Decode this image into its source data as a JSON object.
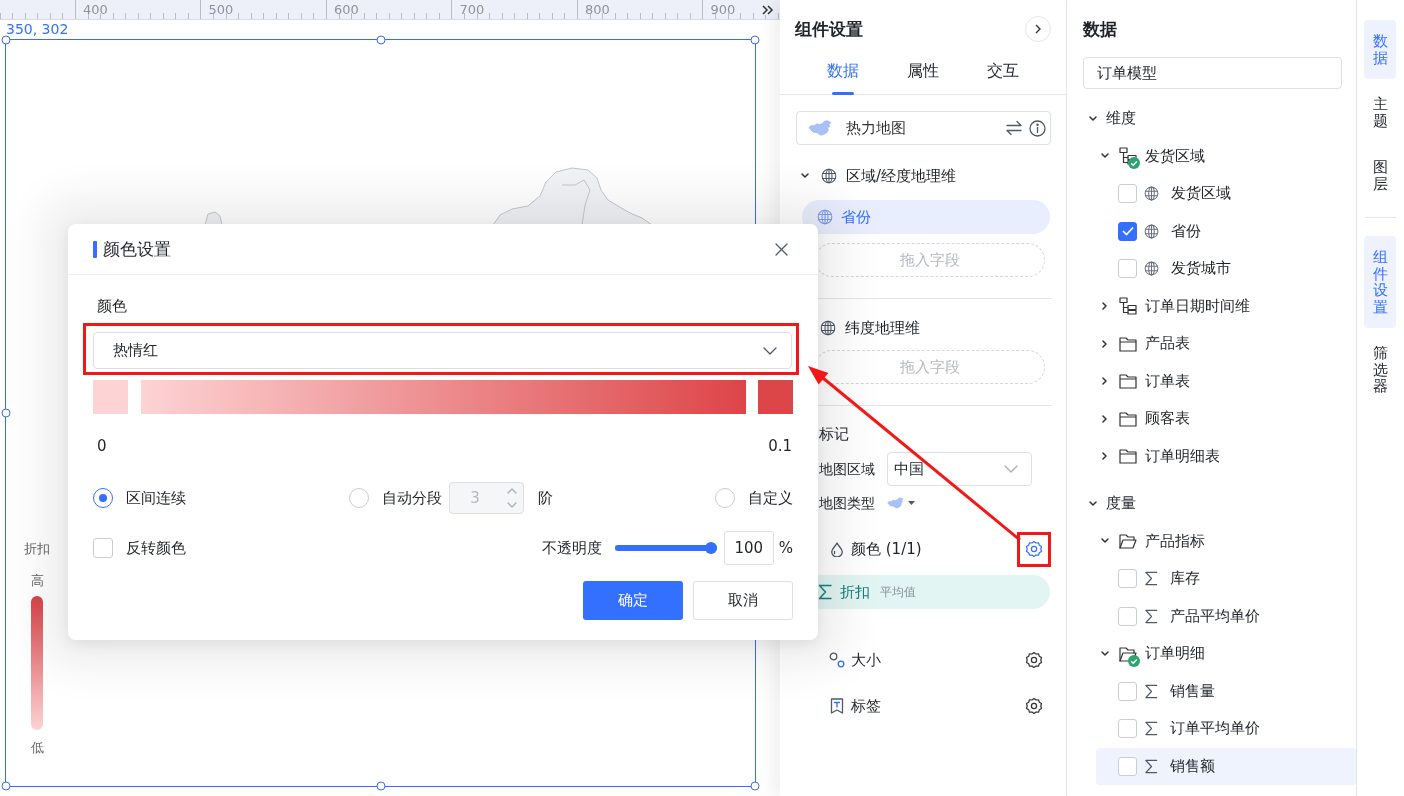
{
  "canvas": {
    "ruler_labels": [
      "400",
      "500",
      "600",
      "700",
      "800",
      "900"
    ],
    "position": "350, 302",
    "legend": {
      "title": "折扣",
      "high": "高",
      "low": "低"
    }
  },
  "color_dialog": {
    "title": "颜色设置",
    "color_label": "颜色",
    "scheme": {
      "value": "热情红",
      "highlighted": true
    },
    "scale_min": "0",
    "scale_max": "0.1",
    "modes": [
      {
        "kind": "plain",
        "label": "区间连续",
        "selected": true
      },
      {
        "kind": "steps",
        "label": "自动分段",
        "selected": false,
        "steps": {
          "value": "3",
          "disabled": true
        },
        "unit": "阶"
      },
      {
        "kind": "plain",
        "label": "自定义",
        "selected": false
      }
    ],
    "reverse": {
      "label": "反转颜色",
      "checked": false
    },
    "opacity": {
      "label": "不透明度",
      "level": 1,
      "value": "100",
      "unit": "%"
    },
    "buttons": [
      {
        "kind": "primary",
        "label": "确定"
      },
      {
        "kind": "secondary",
        "label": "取消"
      }
    ]
  },
  "component_panel": {
    "title": "组件设置",
    "tabs": [
      {
        "label": "数据",
        "selected": true
      },
      {
        "label": "属性",
        "selected": false
      },
      {
        "label": "交互",
        "selected": false
      }
    ],
    "chart_type": "热力地图",
    "region_dimension": {
      "title": "区域/经度地理维",
      "expanded": true,
      "fields": [
        "省份"
      ],
      "drop_hint": "拖入字段"
    },
    "latitude_dimension": {
      "title": "纬度地理维",
      "drop_hint": "拖入字段"
    },
    "marks": {
      "title": "标记",
      "map_region": {
        "label": "地图区域",
        "value": "中国"
      },
      "map_type": {
        "label": "地图类型"
      },
      "channels": [
        {
          "kind": "color",
          "label": "颜色 (1/1)",
          "active": true,
          "highlighted": true,
          "field": {
            "label": "折扣",
            "aggregation": "平均值"
          }
        },
        {
          "kind": "size",
          "label": "大小",
          "active": false,
          "highlighted": false
        },
        {
          "kind": "label",
          "label": "标签",
          "active": false,
          "highlighted": false
        }
      ]
    }
  },
  "annotation_arrow": true,
  "data_panel": {
    "title": "数据",
    "model": "订单模型",
    "tree": [
      {
        "label": "维度",
        "expanded": true,
        "children": [
          {
            "kind": "hierarchy",
            "label": "发货区域",
            "expanded": true,
            "in_use": true,
            "children": [
              {
                "kind": "geo",
                "label": "发货区域",
                "checked": false,
                "selected": false
              },
              {
                "kind": "geo",
                "label": "省份",
                "checked": true,
                "selected": false
              },
              {
                "kind": "geo",
                "label": "发货城市",
                "checked": false,
                "selected": false
              }
            ]
          },
          {
            "kind": "hierarchy",
            "label": "订单日期时间维",
            "expanded": false,
            "in_use": false
          },
          {
            "kind": "folder",
            "label": "产品表",
            "expanded": false,
            "in_use": false
          },
          {
            "kind": "folder",
            "label": "订单表",
            "expanded": false,
            "in_use": false
          },
          {
            "kind": "folder",
            "label": "顾客表",
            "expanded": false,
            "in_use": false
          },
          {
            "kind": "folder",
            "label": "订单明细表",
            "expanded": false,
            "in_use": false
          }
        ]
      },
      {
        "label": "度量",
        "expanded": true,
        "children": [
          {
            "kind": "folder",
            "label": "产品指标",
            "expanded": true,
            "in_use": false,
            "children": [
              {
                "kind": "measure",
                "label": "库存",
                "checked": false,
                "selected": false
              },
              {
                "kind": "measure",
                "label": "产品平均单价",
                "checked": false,
                "selected": false
              }
            ]
          },
          {
            "kind": "folder",
            "label": "订单明细",
            "expanded": true,
            "in_use": true,
            "children": [
              {
                "kind": "measure",
                "label": "销售量",
                "checked": false,
                "selected": false
              },
              {
                "kind": "measure",
                "label": "订单平均单价",
                "checked": false,
                "selected": false
              },
              {
                "kind": "measure",
                "label": "销售额",
                "checked": false,
                "selected": true
              }
            ]
          }
        ]
      }
    ]
  },
  "side_tab_groups": [
    {
      "tabs": [
        {
          "label": "数据",
          "selected": true
        },
        {
          "label": "主题",
          "selected": false
        },
        {
          "label": "图层",
          "selected": false
        }
      ]
    },
    {
      "tabs": [
        {
          "label": "组件设置",
          "selected": true
        },
        {
          "label": "筛选器",
          "selected": false
        }
      ]
    }
  ]
}
